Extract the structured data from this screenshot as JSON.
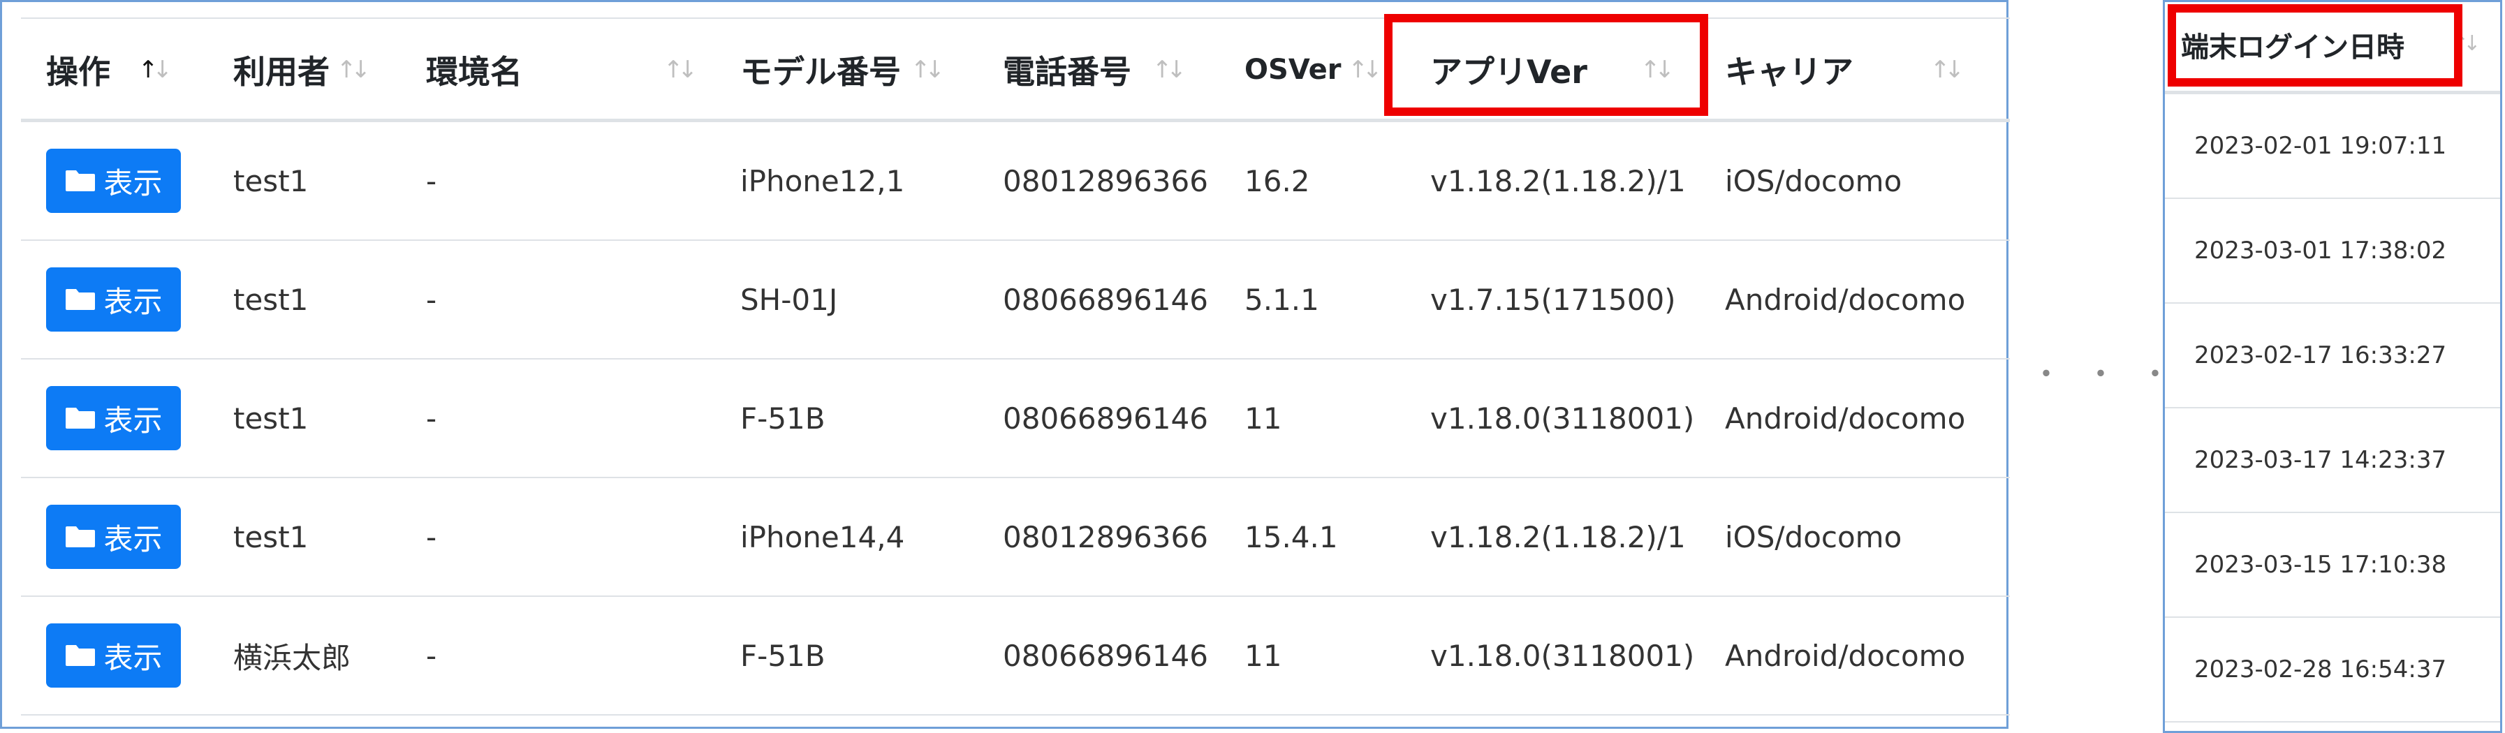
{
  "columns": [
    {
      "label": "操作",
      "sort_icon": "sort-asc-icon"
    },
    {
      "label": "利用者",
      "sort_icon": "sort-both-icon"
    },
    {
      "label": "環境名",
      "sort_icon": "sort-both-icon"
    },
    {
      "label": "モデル番号",
      "sort_icon": "sort-both-icon"
    },
    {
      "label": "電話番号",
      "sort_icon": "sort-both-icon"
    },
    {
      "label": "OSVer",
      "sort_icon": "sort-both-icon"
    },
    {
      "label": "アプリVer",
      "sort_icon": "sort-both-icon"
    },
    {
      "label": "キャリア",
      "sort_icon": "sort-both-icon"
    }
  ],
  "view_button_label": "表示",
  "view_button_icon": "folder-icon",
  "rows": [
    {
      "user": "test1",
      "env": "-",
      "model": "iPhone12,1",
      "phone": "08012896366",
      "os": "16.2",
      "app": "v1.18.2(1.18.2)/1",
      "carrier": "iOS/docomo"
    },
    {
      "user": "test1",
      "env": "-",
      "model": "SH-01J",
      "phone": "08066896146",
      "os": "5.1.1",
      "app": "v1.7.15(171500)",
      "carrier": "Android/docomo"
    },
    {
      "user": "test1",
      "env": "-",
      "model": "F-51B",
      "phone": "08066896146",
      "os": "11",
      "app": "v1.18.0(3118001)",
      "carrier": "Android/docomo"
    },
    {
      "user": "test1",
      "env": "-",
      "model": "iPhone14,4",
      "phone": "08012896366",
      "os": "15.4.1",
      "app": "v1.18.2(1.18.2)/1",
      "carrier": "iOS/docomo"
    },
    {
      "user": "横浜太郎",
      "env": "-",
      "model": "F-51B",
      "phone": "08066896146",
      "os": "11",
      "app": "v1.18.0(3118001)",
      "carrier": "Android/docomo"
    }
  ],
  "side_column": {
    "label": "端末ログイン日時",
    "sort_icon": "sort-both-icon",
    "values": [
      "2023-02-01 19:07:11",
      "2023-03-01 17:38:02",
      "2023-02-17 16:33:27",
      "2023-03-17 14:23:37",
      "2023-03-15 17:10:38",
      "2023-02-28 16:54:37"
    ]
  },
  "ellipsis": "・・・",
  "colors": {
    "button": "#0d7bf5",
    "highlight": "#ee0000",
    "panel_border": "#6f9fd8",
    "row_border": "#dee2e6",
    "sort_inactive": "#bfbfbf"
  }
}
